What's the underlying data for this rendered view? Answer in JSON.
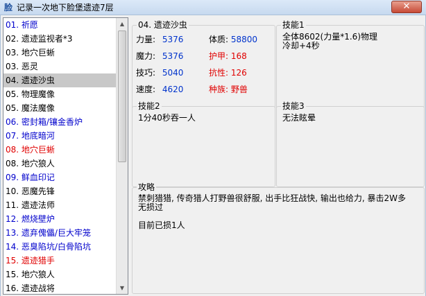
{
  "window": {
    "icon_text": "脸",
    "title": "记录一次地下脸堡遗迹7层",
    "close_label": "✕"
  },
  "monster_list": [
    {
      "label": "01. 祈愿",
      "color": "blue"
    },
    {
      "label": "02. 遗迹监视者*3",
      "color": "black"
    },
    {
      "label": "03. 地穴巨蜥",
      "color": "black"
    },
    {
      "label": "03. 恶灵",
      "color": "black"
    },
    {
      "label": "04. 遗迹沙虫",
      "color": "black",
      "selected": true
    },
    {
      "label": "05. 物理魔像",
      "color": "black"
    },
    {
      "label": "05. 魔法魔像",
      "color": "black"
    },
    {
      "label": "06. 密封箱/镶金香炉",
      "color": "blue"
    },
    {
      "label": "07. 地底暗河",
      "color": "blue"
    },
    {
      "label": "08. 地穴巨蜥",
      "color": "red"
    },
    {
      "label": "08. 地穴狼人",
      "color": "black"
    },
    {
      "label": "09. 鲜血印记",
      "color": "blue"
    },
    {
      "label": "10. 恶魔先锋",
      "color": "black"
    },
    {
      "label": "11. 遗迹法师",
      "color": "black"
    },
    {
      "label": "12. 燃烧壁炉",
      "color": "blue"
    },
    {
      "label": "13. 遗弃傀儡/巨大牢笼",
      "color": "blue"
    },
    {
      "label": "14. 恶臭陷坑/白骨陷坑",
      "color": "blue"
    },
    {
      "label": "15. 遗迹猎手",
      "color": "red"
    },
    {
      "label": "15. 地穴狼人",
      "color": "black"
    },
    {
      "label": "16. 遗迹战将",
      "color": "black"
    }
  ],
  "stats": {
    "title": "04. 遗迹沙虫",
    "strength_label": "力量:",
    "strength_value": "5376",
    "constitution_label": "体质:",
    "constitution_value": "58800",
    "magic_label": "魔力:",
    "magic_value": "5376",
    "armor_label": "护甲:",
    "armor_value": "168",
    "skill_label": "技巧:",
    "skill_value": "5040",
    "resist_label": "抗性:",
    "resist_value": "126",
    "speed_label": "速度:",
    "speed_value": "4620",
    "race_label": "种族:",
    "race_value": "野兽"
  },
  "skill1": {
    "title": "技能1",
    "text": "全体8602(力量*1.6)物理\n冷却+4秒"
  },
  "skill2": {
    "title": "技能2",
    "text": "1分40秒吞一人"
  },
  "skill3": {
    "title": "技能3",
    "text": "无法眩晕"
  },
  "guide": {
    "title": "攻略",
    "text": "禁刺猎猎, 传奇猎人打野兽很舒服, 出手比狂战快, 输出也给力, 暴击2W多\n无损过\n\n目前已损1人"
  },
  "colors": {
    "blue": "#0000cc",
    "red": "#e00000",
    "selected_bg": "#c8c8c8"
  }
}
